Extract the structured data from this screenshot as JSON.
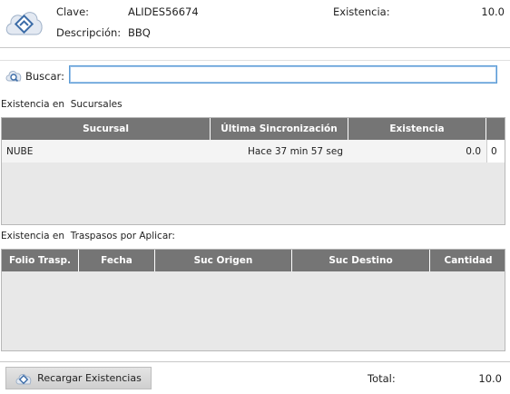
{
  "product": {
    "clave_label": "Clave:",
    "clave_value": "ALIDES56674",
    "existencia_label": "Existencia:",
    "existencia_value": "10.0",
    "descripcion_label": "Descripción:",
    "descripcion_value": "BBQ"
  },
  "search": {
    "label": "Buscar:",
    "value": "",
    "placeholder": ""
  },
  "sucursales": {
    "section_title": "Existencia en  Sucursales",
    "columns": [
      "Sucursal",
      "Última Sincronización",
      "Existencia"
    ],
    "rows": [
      {
        "sucursal": "NUBE",
        "sincronizacion": "Hace 37 min 57 seg",
        "existencia": "0.0",
        "extra": "0"
      }
    ]
  },
  "traspasos": {
    "section_title": "Existencia en  Traspasos por Aplicar:",
    "columns": [
      "Folio Trasp.",
      "Fecha",
      "Suc Origen",
      "Suc Destino",
      "Cantidad"
    ],
    "rows": []
  },
  "footer": {
    "reload_label": "Recargar Existencias",
    "total_label": "Total:",
    "total_value": "10.0"
  },
  "icons": {
    "logo": "cloud-logo-icon",
    "search": "search-icon",
    "reload": "reload-icon"
  },
  "colors": {
    "header_bg": "#757575",
    "grid_bg": "#e8e8e8",
    "focus": "#5b9bd5"
  }
}
